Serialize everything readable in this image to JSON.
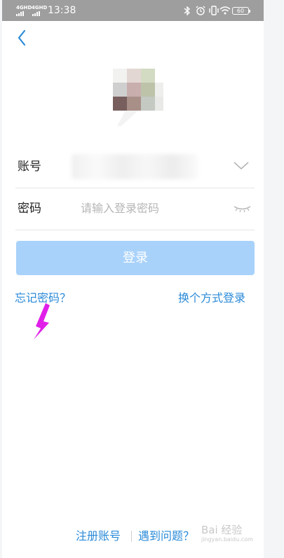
{
  "status_bar": {
    "signal1": "4GHD",
    "signal2": "4GHD",
    "time": "13:38",
    "battery": "60"
  },
  "login_form": {
    "account_label": "账号",
    "password_label": "密码",
    "password_placeholder": "请输入登录密码",
    "login_button": "登录"
  },
  "links": {
    "forgot_password": "忘记密码？",
    "switch_method": "换个方式登录",
    "register": "注册账号",
    "help": "遇到问题？"
  },
  "watermark": {
    "brand": "Bai 经验",
    "url": "jingyan.baidu.com"
  },
  "colors": {
    "accent": "#2a8ad8",
    "button_disabled": "#a9d2fb",
    "annotation_arrow": "#e020e8",
    "status_bar": "#9e9e9e"
  },
  "icons": [
    "back-chevron-icon",
    "dropdown-chevron-icon",
    "eye-closed-icon",
    "bluetooth-icon",
    "alarm-icon",
    "vibrate-icon",
    "wifi-icon",
    "battery-icon"
  ]
}
